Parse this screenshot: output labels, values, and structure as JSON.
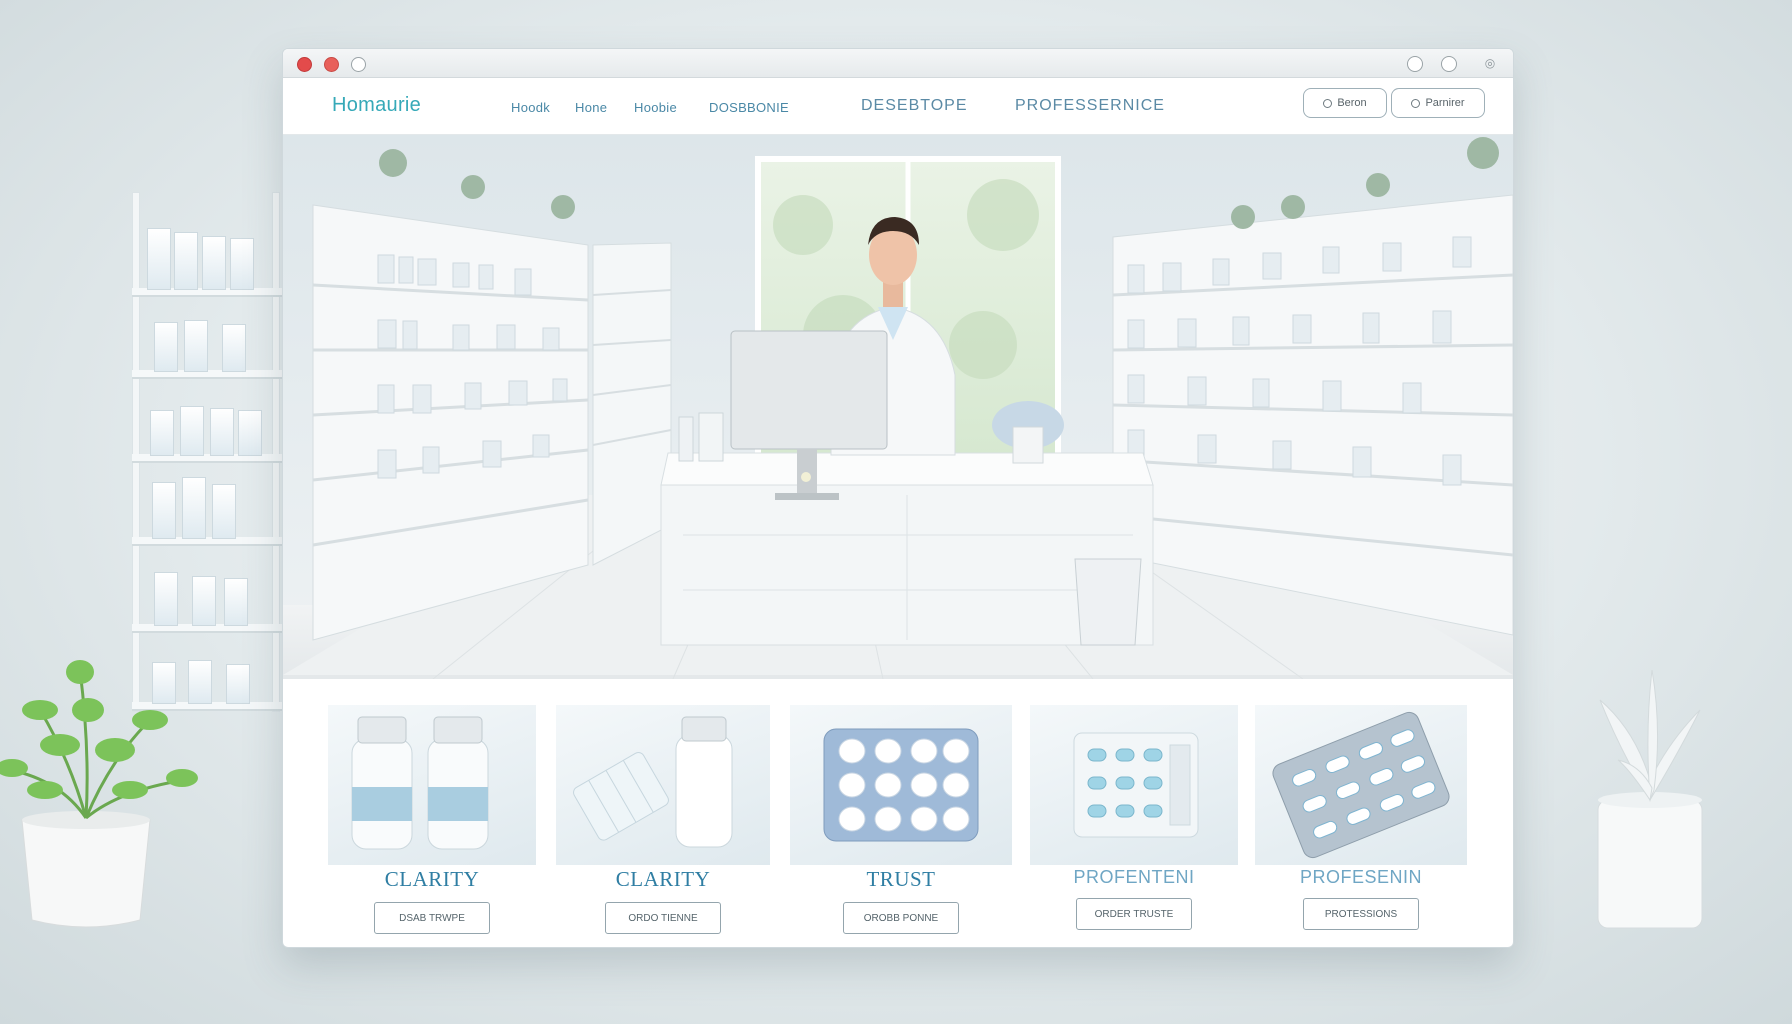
{
  "brand": {
    "logo_text": "Homaurie"
  },
  "nav": {
    "links": [
      "Hoodk",
      "Hone",
      "Hoobie",
      "DOSBBONIE"
    ],
    "sections": [
      "DESEBTOPE",
      "PROFESSERNICE"
    ],
    "buttons": [
      {
        "icon": "circle-icon",
        "label": "Beron"
      },
      {
        "icon": "circle-icon",
        "label": "Parnirer"
      }
    ]
  },
  "colors": {
    "accent": "#36a9b8",
    "label_blue": "#2f7ea3",
    "nav_text": "#5b8aa5"
  },
  "cards": [
    {
      "label": "CLARITY",
      "button": "DSAB TRWPE"
    },
    {
      "label": "CLARITY",
      "button": "ORDO TIENNE"
    },
    {
      "label": "TRUST",
      "button": "OROBB PONNE"
    },
    {
      "label": "PROFENTENI",
      "button": "ORDER TRUSTE"
    },
    {
      "label": "PROFESENIN",
      "button": "PROTESSIONS"
    }
  ]
}
